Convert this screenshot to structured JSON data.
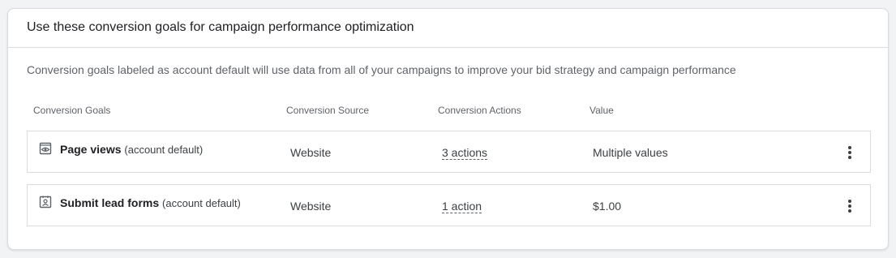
{
  "card": {
    "title": "Use these conversion goals for campaign performance optimization",
    "description": "Conversion goals labeled as account default will use data from all of your campaigns to improve your bid strategy and campaign performance"
  },
  "table": {
    "headers": {
      "goals": "Conversion Goals",
      "source": "Conversion Source",
      "actions": "Conversion Actions",
      "value": "Value"
    },
    "rows": [
      {
        "icon": "eye-page-icon",
        "name": "Page views",
        "suffix": "(account default)",
        "source": "Website",
        "actions": "3 actions",
        "value": "Multiple values"
      },
      {
        "icon": "contact-form-icon",
        "name": "Submit lead forms",
        "suffix": "(account default)",
        "source": "Website",
        "actions": "1 action",
        "value": "$1.00"
      }
    ]
  },
  "colors": {
    "border": "#dadce0",
    "text_primary": "#202124",
    "text_secondary": "#5f6368"
  }
}
